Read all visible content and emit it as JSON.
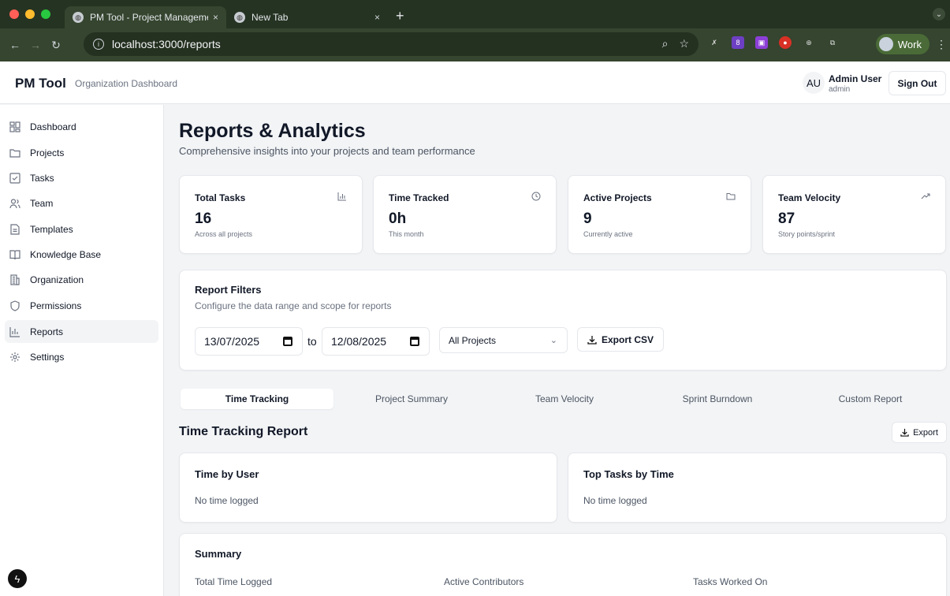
{
  "browser": {
    "tabs": [
      {
        "title": "PM Tool - Project Manageme",
        "close": "×"
      },
      {
        "title": "New Tab",
        "close": "×"
      }
    ],
    "new_tab": "+",
    "url": "localhost:3000/reports",
    "profile": "Work",
    "ext_badge": "8"
  },
  "header": {
    "brand": "PM Tool",
    "subtitle": "Organization Dashboard",
    "user_initials": "AU",
    "user_name": "Admin User",
    "user_role": "admin",
    "sign_out": "Sign Out"
  },
  "sidebar": {
    "items": [
      {
        "label": "Dashboard",
        "icon": "grid-icon"
      },
      {
        "label": "Projects",
        "icon": "folder-icon"
      },
      {
        "label": "Tasks",
        "icon": "checkbox-icon"
      },
      {
        "label": "Team",
        "icon": "users-icon"
      },
      {
        "label": "Templates",
        "icon": "file-icon"
      },
      {
        "label": "Knowledge Base",
        "icon": "book-icon"
      },
      {
        "label": "Organization",
        "icon": "building-icon"
      },
      {
        "label": "Permissions",
        "icon": "shield-icon"
      },
      {
        "label": "Reports",
        "icon": "bar-chart-icon"
      },
      {
        "label": "Settings",
        "icon": "gear-icon"
      }
    ],
    "active": "Reports"
  },
  "page": {
    "title": "Reports & Analytics",
    "subtitle": "Comprehensive insights into your projects and team performance"
  },
  "stats": [
    {
      "title": "Total Tasks",
      "value": "16",
      "sub": "Across all projects",
      "icon": "bar-chart-icon"
    },
    {
      "title": "Time Tracked",
      "value": "0h",
      "sub": "This month",
      "icon": "clock-icon"
    },
    {
      "title": "Active Projects",
      "value": "9",
      "sub": "Currently active",
      "icon": "folder-icon"
    },
    {
      "title": "Team Velocity",
      "value": "87",
      "sub": "Story points/sprint",
      "icon": "trending-up-icon"
    }
  ],
  "filters": {
    "title": "Report Filters",
    "subtitle": "Configure the data range and scope for reports",
    "date_from": "13/07/2025",
    "to": "to",
    "date_to": "12/08/2025",
    "project_select": "All Projects",
    "export_csv": "Export CSV"
  },
  "report_tabs": [
    {
      "label": "Time Tracking"
    },
    {
      "label": "Project Summary"
    },
    {
      "label": "Team Velocity"
    },
    {
      "label": "Sprint Burndown"
    },
    {
      "label": "Custom Report"
    }
  ],
  "active_tab": "Time Tracking",
  "time_report": {
    "title": "Time Tracking Report",
    "export": "Export",
    "by_user_title": "Time by User",
    "by_user_empty": "No time logged",
    "top_tasks_title": "Top Tasks by Time",
    "top_tasks_empty": "No time logged",
    "summary_title": "Summary",
    "summary_labels": [
      "Total Time Logged",
      "Active Contributors",
      "Tasks Worked On"
    ]
  }
}
